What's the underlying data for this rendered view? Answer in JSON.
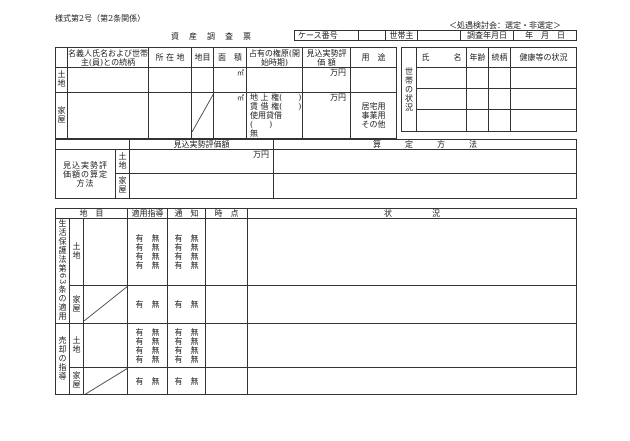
{
  "form_number": "様式第2号（第2条関係）",
  "committee_note": "＜処遇検討会：選定・非選定＞",
  "title": "資　産　調　査　票",
  "header": {
    "case_no_label": "ケース番号",
    "householder_label": "世帯主",
    "survey_date_label": "調査年月日",
    "date_fields": "年　月　日"
  },
  "assets": {
    "col_name": "名義人氏名および世帯主(員)との続柄",
    "col_location": "所 在 地",
    "col_land_category": "地目",
    "col_area": "面　積",
    "col_rights": "占有の権原(開始時期)",
    "col_value": "見込実勢評 価 額",
    "col_use": "用　途",
    "row_land": "土地",
    "row_house": "家屋",
    "unit_m2": "㎡",
    "unit_yen": "万円",
    "rights_options": [
      "地 上 権(　　)",
      "賃 借 権(　　)",
      "使用貸借(　　)",
      "無"
    ],
    "use_options": [
      "居宅用",
      "事業用",
      "その他"
    ]
  },
  "household": {
    "side_label": "世帯の状況",
    "col_name": "氏　　　名",
    "col_age": "年齢",
    "col_relation": "続柄",
    "col_health": "健康等の状況"
  },
  "valuation": {
    "header_value": "見込実勢評価額",
    "header_method": "算　　　定　　　方　　　法",
    "side_label": "見込実勢評価額の算定方法",
    "row_land": "土地",
    "row_house": "家屋",
    "unit_yen": "万円"
  },
  "guidance": {
    "col_land_category": "地　目",
    "col_applied": "適用指導",
    "col_notice": "通　知",
    "col_time": "時　点",
    "col_status": "状　　　　　況",
    "group1_label": "生活保護法第63条の適用",
    "group2_label": "売却の指導",
    "row_land": "土地",
    "row_house": "家屋",
    "yes": "有",
    "no": "無",
    "yes_no": "有　無"
  }
}
